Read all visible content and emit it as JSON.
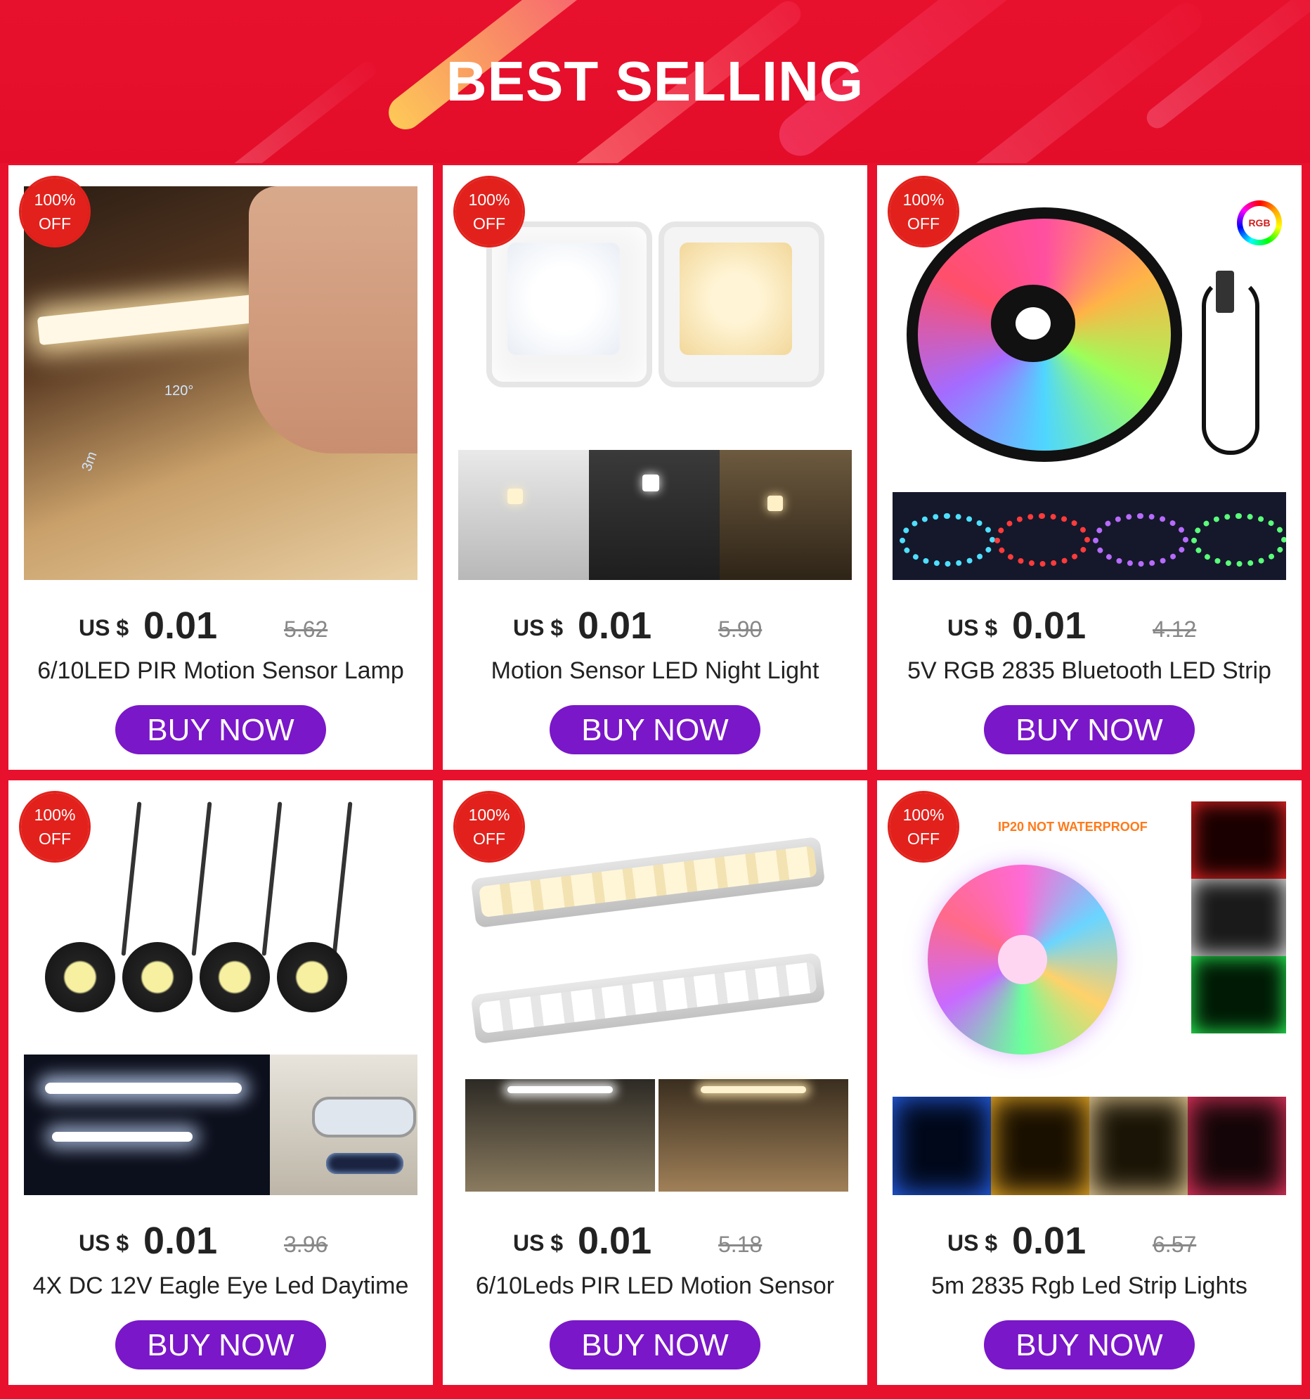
{
  "banner": {
    "title": "BEST SELLING"
  },
  "badge": {
    "line1": "100%",
    "line2": "OFF"
  },
  "products": [
    {
      "currency": "US $",
      "price": "0.01",
      "old_price": "5.62",
      "title": "6/10LED PIR Motion Sensor Lamp",
      "button": "BUY NOW"
    },
    {
      "currency": "US $",
      "price": "0.01",
      "old_price": "5.90",
      "title": "Motion Sensor LED Night Light",
      "button": "BUY NOW"
    },
    {
      "currency": "US $",
      "price": "0.01",
      "old_price": "4.12",
      "title": "5V RGB 2835 Bluetooth LED Strip",
      "button": "BUY NOW",
      "image_tag": "RGB"
    },
    {
      "currency": "US $",
      "price": "0.01",
      "old_price": "3.96",
      "title": "4X DC 12V Eagle Eye Led Daytime",
      "button": "BUY NOW"
    },
    {
      "currency": "US $",
      "price": "0.01",
      "old_price": "5.18",
      "title": "6/10Leds PIR LED Motion Sensor",
      "button": "BUY NOW"
    },
    {
      "currency": "US $",
      "price": "0.01",
      "old_price": "6.57",
      "title": "5m 2835 Rgb Led Strip Lights",
      "button": "BUY NOW",
      "image_tag": "IP20 NOT WATERPROOF"
    }
  ],
  "image_labels": {
    "angle": "120°",
    "distance": "3m"
  }
}
